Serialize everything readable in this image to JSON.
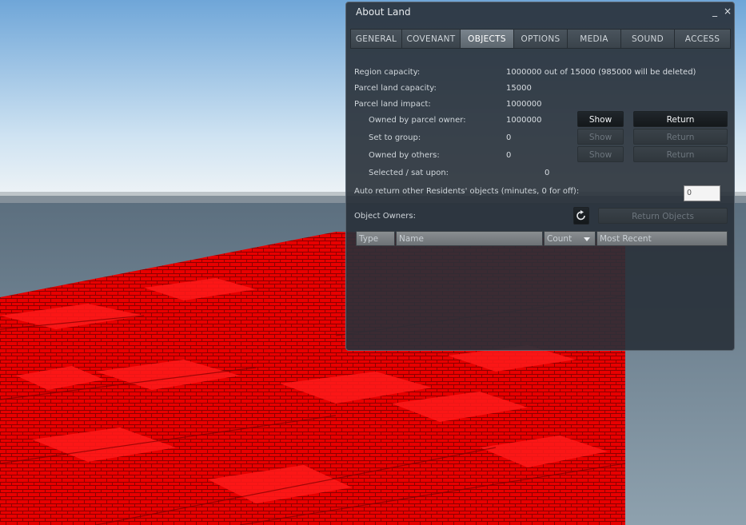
{
  "window": {
    "title": "About Land",
    "minimize": "_",
    "close": "×"
  },
  "tabs": [
    "GENERAL",
    "COVENANT",
    "OBJECTS",
    "OPTIONS",
    "MEDIA",
    "SOUND",
    "ACCESS"
  ],
  "active_tab": "OBJECTS",
  "rows": {
    "region_capacity": {
      "label": "Region capacity:",
      "value": "1000000 out of 15000 (985000 will be deleted)"
    },
    "parcel_capacity": {
      "label": "Parcel land capacity:",
      "value": "15000"
    },
    "parcel_impact": {
      "label": "Parcel land impact:",
      "value": "1000000"
    },
    "owned_by_owner": {
      "label": "Owned by parcel owner:",
      "value": "1000000",
      "show": "Show",
      "return": "Return"
    },
    "set_to_group": {
      "label": "Set to group:",
      "value": "0",
      "show": "Show",
      "return": "Return"
    },
    "owned_by_others": {
      "label": "Owned by others:",
      "value": "0",
      "show": "Show",
      "return": "Return"
    },
    "selected": {
      "label": "Selected / sat upon:",
      "value": "0"
    }
  },
  "auto_return": {
    "label": "Auto return other Residents' objects (minutes, 0 for off):",
    "value": "0"
  },
  "object_owners": {
    "label": "Object Owners:",
    "return_objects": "Return Objects"
  },
  "columns": [
    "Type",
    "Name",
    "Count",
    "Most Recent"
  ]
}
